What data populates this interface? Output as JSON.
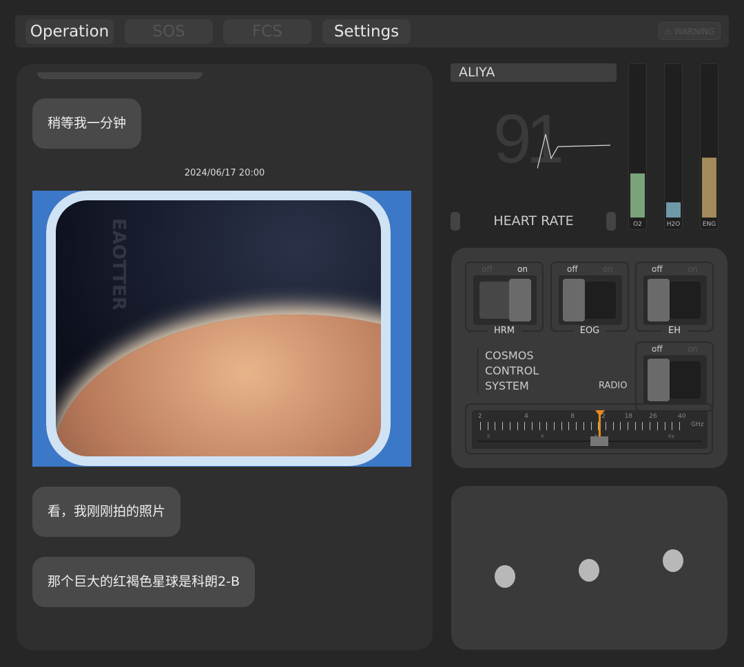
{
  "nav": {
    "tabs": [
      {
        "label": "Operation"
      },
      {
        "label": "SOS"
      },
      {
        "label": "FCS"
      },
      {
        "label": "Settings"
      }
    ],
    "warning": "⚠ WARNING"
  },
  "chat": {
    "messages": [
      {
        "text": "稍等我一分钟"
      },
      {
        "timestamp": "2024/06/17  20:00"
      },
      {
        "text": "看，我刚刚拍的照片"
      },
      {
        "text": "那个巨大的红褐色星球是科朗2-B"
      }
    ],
    "photo_watermark": "EAOTTER"
  },
  "vitals": {
    "name": "ALIYA",
    "heart_rate": "91",
    "heart_rate_label": "HEART RATE",
    "gauges": [
      {
        "label": "O2",
        "level": 0.29,
        "color": "#7aa37a"
      },
      {
        "label": "H2O",
        "level": 0.1,
        "color": "#6e9aa8"
      },
      {
        "label": "ENG",
        "level": 0.39,
        "color": "#a38a5a"
      }
    ]
  },
  "control": {
    "switches": [
      {
        "name": "HRM",
        "state": "on"
      },
      {
        "name": "EOG",
        "state": "off"
      },
      {
        "name": "EH",
        "state": "off"
      },
      {
        "name": "RADIO",
        "state": "off"
      }
    ],
    "off": "off",
    "on": "on",
    "title": [
      "COSMOS",
      "CONTROL",
      "SYSTEM"
    ],
    "radio_label": "RADIO",
    "tuner": {
      "unit": "GHz",
      "ticks": [
        "2",
        "4",
        "8",
        "12",
        "18",
        "26",
        "40"
      ],
      "bands": [
        "S",
        "X",
        "Ku",
        "Ka"
      ],
      "value_ghz": 12,
      "accent": "#e88a1a"
    }
  },
  "pad": {
    "dots": 3
  }
}
